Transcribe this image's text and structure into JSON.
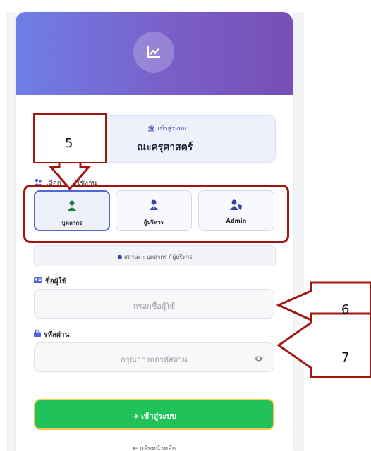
{
  "header": {
    "logo_icon": "chart-line-icon"
  },
  "system": {
    "login_label": "เข้าสู่ระบบ",
    "faculty_name": "ณะครุศาสตร์",
    "bank_icon": "building-columns-icon"
  },
  "role_select": {
    "label": "เลือก     ทกผู้ใช้งาน",
    "options": [
      {
        "label": "บุคลากร",
        "icon": "user-icon",
        "active": true
      },
      {
        "label": "ผู้บริหาร",
        "icon": "user-tie-icon",
        "active": false
      },
      {
        "label": "Admin",
        "icon": "user-shield-icon",
        "active": false
      }
    ]
  },
  "status": {
    "text": "สถานะ : บุคลากร / ผู้บริหาร",
    "icon": "info-circle-icon"
  },
  "username": {
    "label": "ชื่อผู้ใช้",
    "placeholder": "กรอกชื่อผู้ใช้",
    "icon": "id-card-icon"
  },
  "password": {
    "label": "รหัสผ่าน",
    "placeholder": "กรุณากรอกรหัสผ่าน",
    "icon": "lock-icon",
    "toggle_icon": "eye-icon"
  },
  "login_button": {
    "label": "เข้าสู่ระบบ",
    "icon": "sign-in-icon"
  },
  "back_link": {
    "label": "← กลับหน้าหลัก"
  },
  "annotations": {
    "five": "5",
    "six": "6",
    "seven": "7",
    "color": "#a1170f"
  },
  "colors": {
    "accent": "#5468d4",
    "success": "#22c25a",
    "header_start": "#6e7fe6",
    "header_end": "#7650b5"
  }
}
